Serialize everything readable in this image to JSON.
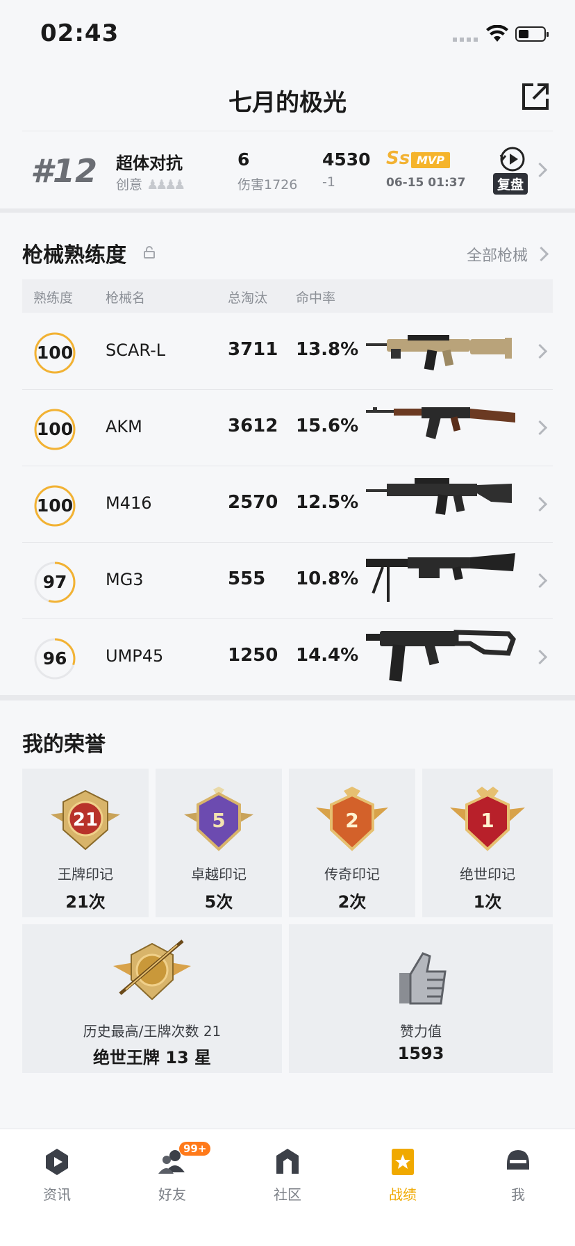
{
  "status": {
    "time": "02:43"
  },
  "header": {
    "title": "七月的极光"
  },
  "match": {
    "rank": "#12",
    "mode": "超体对抗",
    "mode_sub": "创意",
    "kills": "6",
    "damage": "伤害1726",
    "score": "4530",
    "score_change": "-1",
    "grade": "Ss⁺",
    "mvp": "MVP",
    "time": "06-15 01:37",
    "replay_label": "复盘"
  },
  "weapons": {
    "title": "枪械熟练度",
    "all_link": "全部枪械",
    "columns": {
      "mastery": "熟练度",
      "name": "枪械名",
      "kills": "总淘汰",
      "accuracy": "命中率"
    },
    "rows": [
      {
        "mastery": "100",
        "mastery_fraction": 1.0,
        "name": "SCAR-L",
        "kills": "3711",
        "accuracy": "13.8%"
      },
      {
        "mastery": "100",
        "mastery_fraction": 1.0,
        "name": "AKM",
        "kills": "3612",
        "accuracy": "15.6%"
      },
      {
        "mastery": "100",
        "mastery_fraction": 1.0,
        "name": "M416",
        "kills": "2570",
        "accuracy": "12.5%"
      },
      {
        "mastery": "97",
        "mastery_fraction": 0.55,
        "name": "MG3",
        "kills": "555",
        "accuracy": "10.8%"
      },
      {
        "mastery": "96",
        "mastery_fraction": 0.3,
        "name": "UMP45",
        "kills": "1250",
        "accuracy": "14.4%"
      }
    ]
  },
  "honor": {
    "title": "我的荣誉",
    "medals": [
      {
        "label": "王牌印记",
        "count": "21次",
        "number": "21",
        "color": "#b8322a"
      },
      {
        "label": "卓越印记",
        "count": "5次",
        "number": "5",
        "color": "#6c4bb0"
      },
      {
        "label": "传奇印记",
        "count": "2次",
        "number": "2",
        "color": "#d3612a"
      },
      {
        "label": "绝世印记",
        "count": "1次",
        "number": "1",
        "color": "#b8202a"
      }
    ],
    "highest": {
      "label": "历史最高/王牌次数 21",
      "value": "绝世王牌 13 星"
    },
    "likes": {
      "label": "赞力值",
      "value": "1593"
    }
  },
  "tabs": [
    {
      "label": "资讯",
      "icon": "news-icon"
    },
    {
      "label": "好友",
      "icon": "friends-icon",
      "badge": "99+"
    },
    {
      "label": "社区",
      "icon": "community-icon"
    },
    {
      "label": "战绩",
      "icon": "record-icon",
      "active": true
    },
    {
      "label": "我",
      "icon": "me-icon"
    }
  ],
  "colors": {
    "accent": "#f2b233",
    "active_tab": "#f0a900"
  }
}
